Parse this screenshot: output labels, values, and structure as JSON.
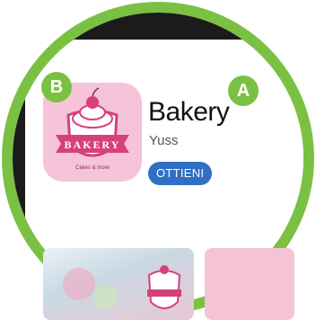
{
  "app": {
    "name": "Bakery",
    "developer": "Yuss",
    "get_label": "OTTIENI",
    "icon_name": "bakery-cupcake-icon",
    "icon_text": "BAKERY",
    "icon_tagline": "Cakes & more"
  },
  "callouts": {
    "a": "A",
    "b": "B"
  },
  "colors": {
    "frame_green": "#7ac143",
    "icon_background": "#f5c4d8",
    "icon_accent": "#d6417a",
    "button_blue": "#2f6fc4"
  }
}
